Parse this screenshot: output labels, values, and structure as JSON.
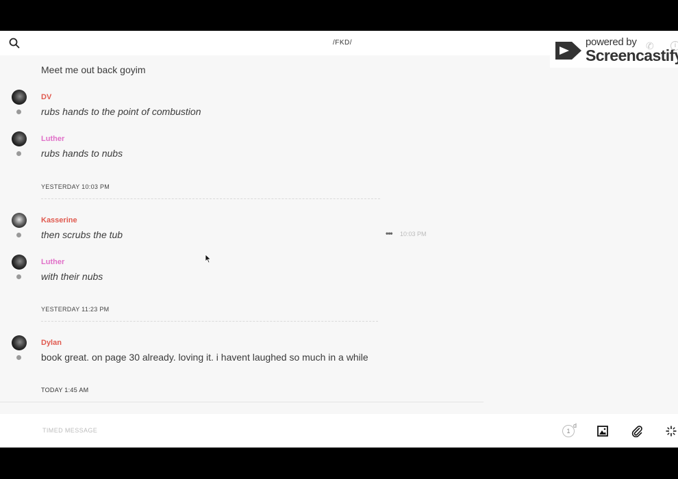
{
  "header": {
    "title": "/FKD/"
  },
  "watermark": {
    "small_text": "powered by",
    "brand_text": "Screencastify"
  },
  "messages": [
    {
      "text": "Meet me out back goyim"
    },
    {
      "sender": "DV",
      "text": "rubs hands to the point of combustion"
    },
    {
      "sender": "Luther",
      "text": "rubs hands to nubs"
    },
    {
      "divider": "YESTERDAY 10:03 PM"
    },
    {
      "sender": "Kasserine",
      "text": "then scrubs the tub",
      "time": "10:03 PM",
      "more": "•••"
    },
    {
      "sender": "Luther",
      "text": "with their nubs"
    },
    {
      "divider": "YESTERDAY 11:23 PM"
    },
    {
      "sender": "Dylan",
      "text": "book great. on page 30 already. loving it. i havent laughed so much in a while"
    },
    {
      "divider": "TODAY 1:45 AM"
    }
  ],
  "composer": {
    "placeholder": "TIMED MESSAGE",
    "timer_value": "1",
    "timer_unit": "d"
  },
  "icons": {
    "search": "search-icon",
    "image": "image-icon",
    "attach": "paperclip-icon",
    "effects": "sparkle-icon",
    "phone": "phone-icon",
    "info": "info-icon"
  },
  "colors": {
    "sender_red": "#e05a4f",
    "sender_pink": "#e070c8",
    "background": "#f7f7f7"
  }
}
